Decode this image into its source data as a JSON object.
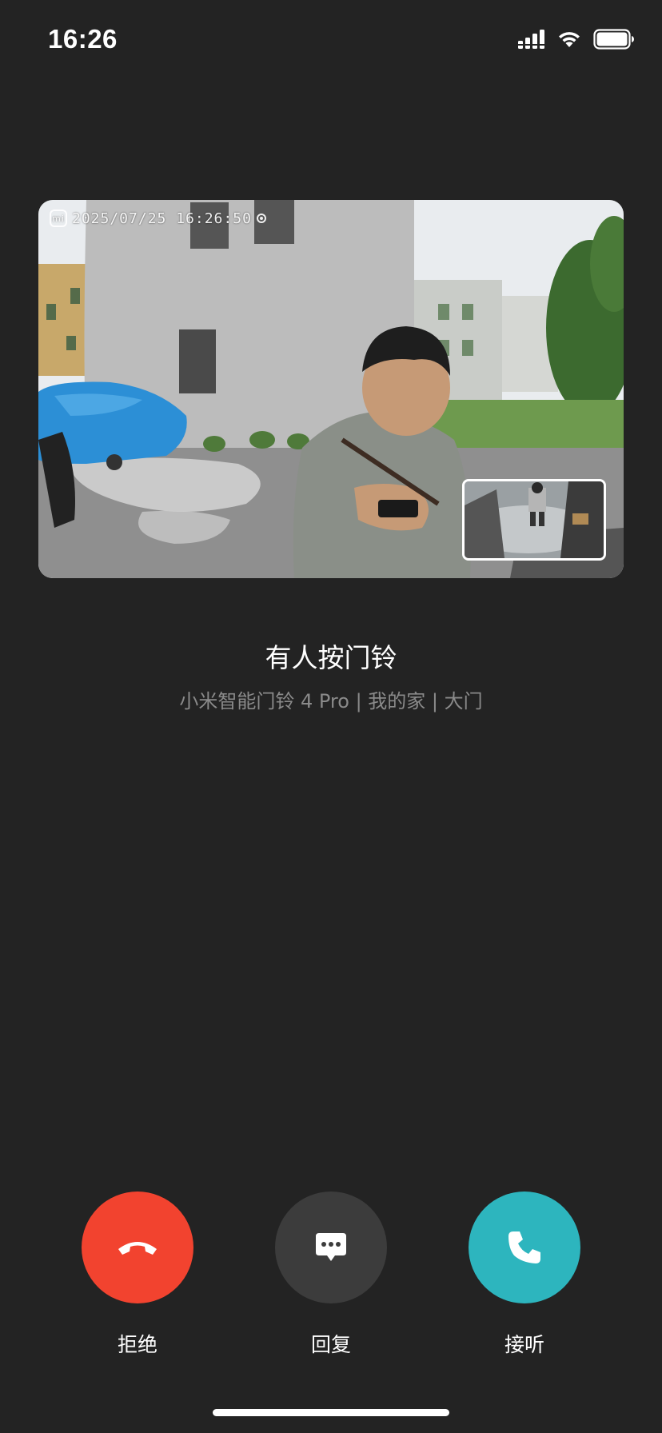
{
  "status_bar": {
    "time": "16:26",
    "icons": [
      "signal-icon",
      "wifi-icon",
      "battery-icon"
    ]
  },
  "video": {
    "logo_text": "mi",
    "timestamp": "2025/07/25  16:26:50"
  },
  "call": {
    "title": "有人按门铃",
    "subtitle": "小米智能门铃 4 Pro | 我的家 | 大门"
  },
  "actions": {
    "decline": {
      "label": "拒绝",
      "color": "#f2432f",
      "icon": "phone-hangup-icon"
    },
    "reply": {
      "label": "回复",
      "color": "#3c3c3c",
      "icon": "message-icon"
    },
    "answer": {
      "label": "接听",
      "color": "#2db5be",
      "icon": "phone-icon"
    }
  }
}
